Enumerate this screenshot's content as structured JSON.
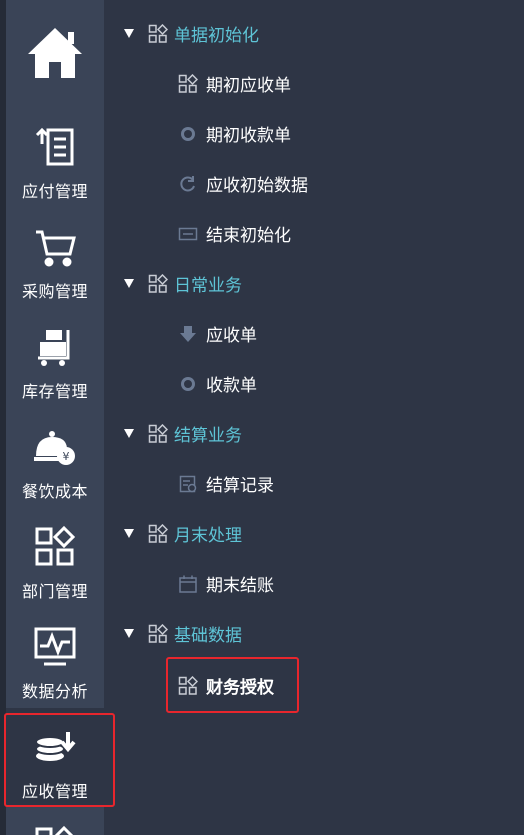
{
  "sidebar": {
    "items": [
      {
        "label": "",
        "icon": "home-icon"
      },
      {
        "label": "应付管理",
        "icon": "payable-icon"
      },
      {
        "label": "采购管理",
        "icon": "cart-icon"
      },
      {
        "label": "库存管理",
        "icon": "inventory-cart-icon"
      },
      {
        "label": "餐饮成本",
        "icon": "cloche-yen-icon"
      },
      {
        "label": "部门管理",
        "icon": "department-grid-icon"
      },
      {
        "label": "数据分析",
        "icon": "chart-monitor-icon"
      },
      {
        "label": "应收管理",
        "icon": "coins-arrow-icon"
      },
      {
        "label": "",
        "icon": "grid-icon"
      }
    ],
    "active_index": 7
  },
  "tree": {
    "groups": [
      {
        "label": "单据初始化",
        "children": [
          {
            "label": "期初应收单",
            "icon": "grid-icon"
          },
          {
            "label": "期初收款单",
            "icon": "coin-icon"
          },
          {
            "label": "应收初始数据",
            "icon": "refresh-icon"
          },
          {
            "label": "结束初始化",
            "icon": "end-box-icon"
          }
        ]
      },
      {
        "label": "日常业务",
        "children": [
          {
            "label": "应收单",
            "icon": "download-arrow-icon"
          },
          {
            "label": "收款单",
            "icon": "coin-icon"
          }
        ]
      },
      {
        "label": "结算业务",
        "children": [
          {
            "label": "结算记录",
            "icon": "record-icon"
          }
        ]
      },
      {
        "label": "月末处理",
        "children": [
          {
            "label": "期末结账",
            "icon": "calendar-icon"
          }
        ]
      },
      {
        "label": "基础数据",
        "children": [
          {
            "label": "财务授权",
            "icon": "grid-icon"
          }
        ]
      }
    ]
  },
  "colors": {
    "sidebar_bg": "#3a4457",
    "tree_bg": "#2e3545",
    "group_text": "#5ec4d6",
    "highlight": "#e8262d"
  }
}
